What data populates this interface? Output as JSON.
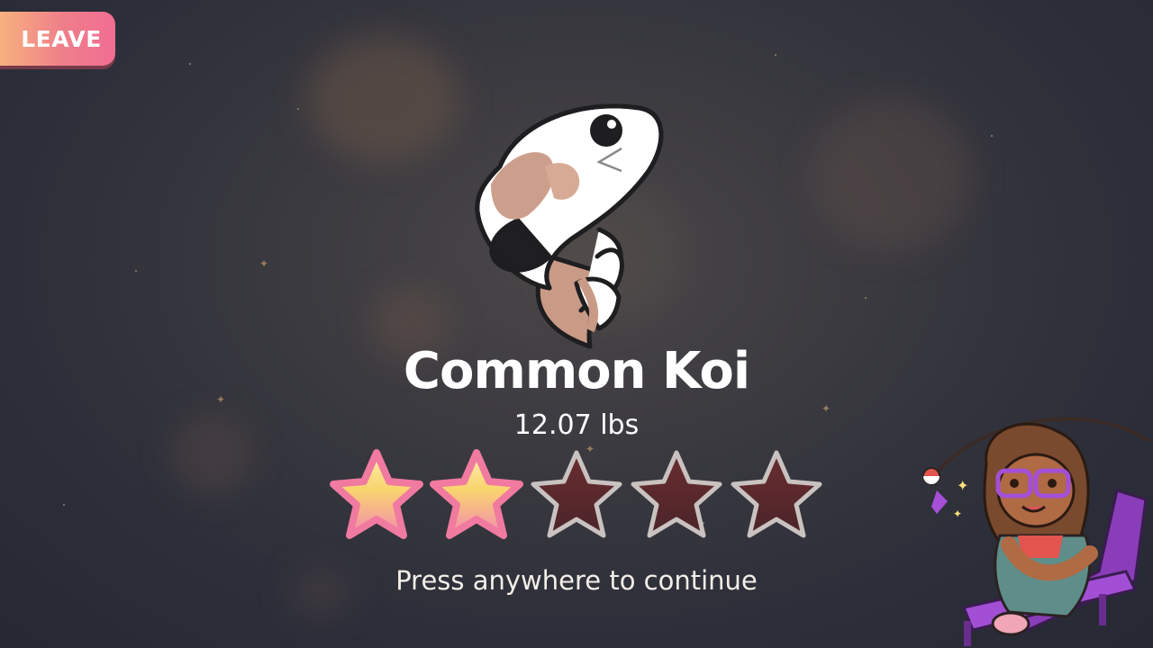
{
  "leave_button": {
    "label": "LEAVE"
  },
  "catch": {
    "name": "Common Koi",
    "weight": "12.07 lbs",
    "rating": {
      "filled": 2,
      "total": 5
    }
  },
  "prompt": "Press anywhere to continue",
  "colors": {
    "leave_gradient": [
      "#f7b17f",
      "#f06d93"
    ],
    "star_filled": "#f9d46e",
    "star_empty": "#5a2a2e",
    "background": "#2c2e39"
  },
  "icons": {
    "fish": "koi-fish-illustration",
    "star_filled": "star-filled-icon",
    "star_empty": "star-empty-icon",
    "character": "fishing-girl-character"
  }
}
